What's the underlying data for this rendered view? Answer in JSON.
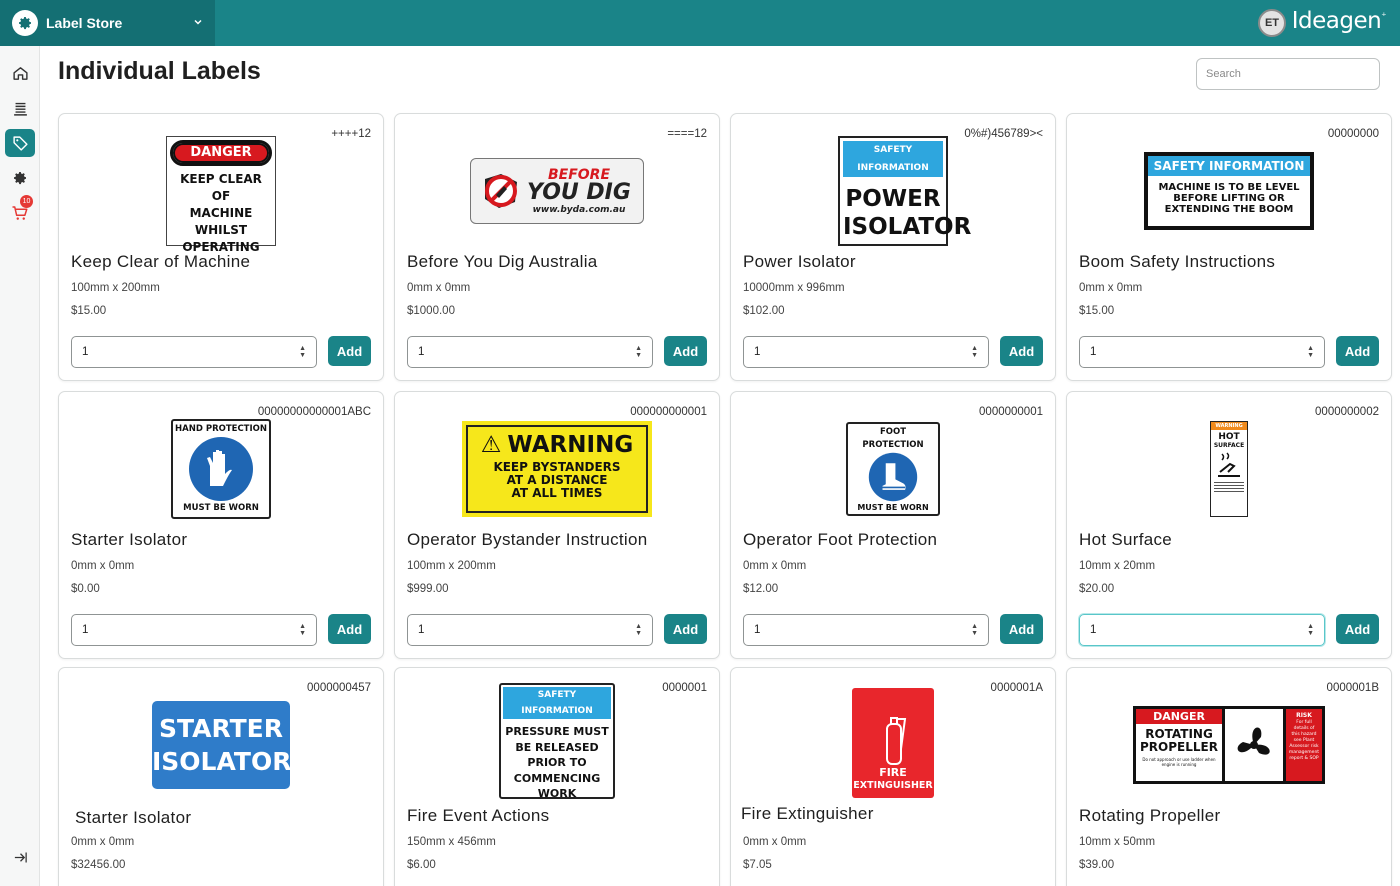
{
  "app": {
    "name": "Label Store",
    "brand": "Ideagen",
    "user_initials": "ET"
  },
  "sidebar": {
    "cart_count": "10"
  },
  "page": {
    "title": "Individual Labels",
    "search_placeholder": "Search"
  },
  "add_label": "Add",
  "products": [
    {
      "name": "Keep Clear of Machine",
      "size": "100mm x 200mm",
      "price": "$15.00",
      "sku": "++++12",
      "qty": "1",
      "sign": {
        "header": "DANGER",
        "lines": [
          "KEEP CLEAR OF",
          "MACHINE",
          "WHILST",
          "OPERATING"
        ]
      }
    },
    {
      "name": "Before You Dig Australia",
      "size": "0mm x 0mm",
      "price": "$1000.00",
      "sku": "====12",
      "qty": "1",
      "sign": {
        "line1": "BEFORE",
        "line2": "YOU DIG",
        "url": "www.byda.com.au"
      }
    },
    {
      "name": "Power Isolator",
      "size": "10000mm x 996mm",
      "price": "$102.00",
      "sku": "0%#)456789><",
      "qty": "1",
      "sign": {
        "header": "SAFETY INFORMATION",
        "lines": [
          "POWER",
          "ISOLATOR"
        ]
      }
    },
    {
      "name": "Boom Safety Instructions",
      "size": "0mm x 0mm",
      "price": "$15.00",
      "sku": "00000000",
      "qty": "1",
      "sign": {
        "header": "SAFETY INFORMATION",
        "lines": [
          "MACHINE IS TO BE LEVEL",
          "BEFORE LIFTING OR",
          "EXTENDING THE BOOM"
        ]
      }
    },
    {
      "name": "Starter Isolator",
      "size": "0mm x 0mm",
      "price": "$0.00",
      "sku": "00000000000001ABC",
      "qty": "1",
      "sign": {
        "header": "HAND PROTECTION",
        "footer": "MUST BE WORN"
      }
    },
    {
      "name": "Operator Bystander Instruction",
      "size": "100mm x 200mm",
      "price": "$999.00",
      "sku": "000000000001",
      "qty": "1",
      "sign": {
        "header": "WARNING",
        "lines": [
          "KEEP BYSTANDERS",
          "AT A  DISTANCE",
          "AT ALL TIMES"
        ]
      }
    },
    {
      "name": "Operator Foot Protection",
      "size": "0mm x 0mm",
      "price": "$12.00",
      "sku": "0000000001",
      "qty": "1",
      "sign": {
        "header": "FOOT PROTECTION",
        "footer": "MUST BE WORN"
      }
    },
    {
      "name": "Hot Surface",
      "size": "10mm x 20mm",
      "price": "$20.00",
      "sku": "0000000002",
      "qty": "1",
      "sign": {
        "header": "WARNING",
        "lines": [
          "HOT",
          "SURFACE"
        ]
      }
    },
    {
      "name": "Starter Isolator",
      "size": "0mm x 0mm",
      "price": "$32456.00",
      "sku": "0000000457",
      "qty": "1",
      "sign": {
        "lines": [
          "STARTER",
          "ISOLATOR"
        ]
      }
    },
    {
      "name": "Fire Event Actions",
      "size": "150mm x 456mm",
      "price": "$6.00",
      "sku": "0000001",
      "qty": "1",
      "sign": {
        "header": "SAFETY INFORMATION",
        "lines": [
          "PRESSURE MUST",
          "BE RELEASED",
          "PRIOR TO",
          "COMMENCING",
          "WORK"
        ]
      }
    },
    {
      "name": "Fire Extinguisher",
      "size": "0mm x 0mm",
      "price": "$7.05",
      "sku": "0000001A",
      "qty": "1",
      "sign": {
        "lines": [
          "FIRE",
          "EXTINGUISHER"
        ]
      }
    },
    {
      "name": "Rotating Propeller",
      "size": "10mm x 50mm",
      "price": "$39.00",
      "sku": "0000001B",
      "qty": "1",
      "sign": {
        "header": "DANGER",
        "lines": [
          "ROTATING",
          "PROPELLER"
        ],
        "small": "Do not approach or use ladder when engine is running",
        "side_header": "RISK",
        "side_lines": [
          "For full",
          "details of",
          "this hazard",
          "see Plant",
          "Assessor risk",
          "management",
          "report & SOP"
        ]
      }
    }
  ]
}
